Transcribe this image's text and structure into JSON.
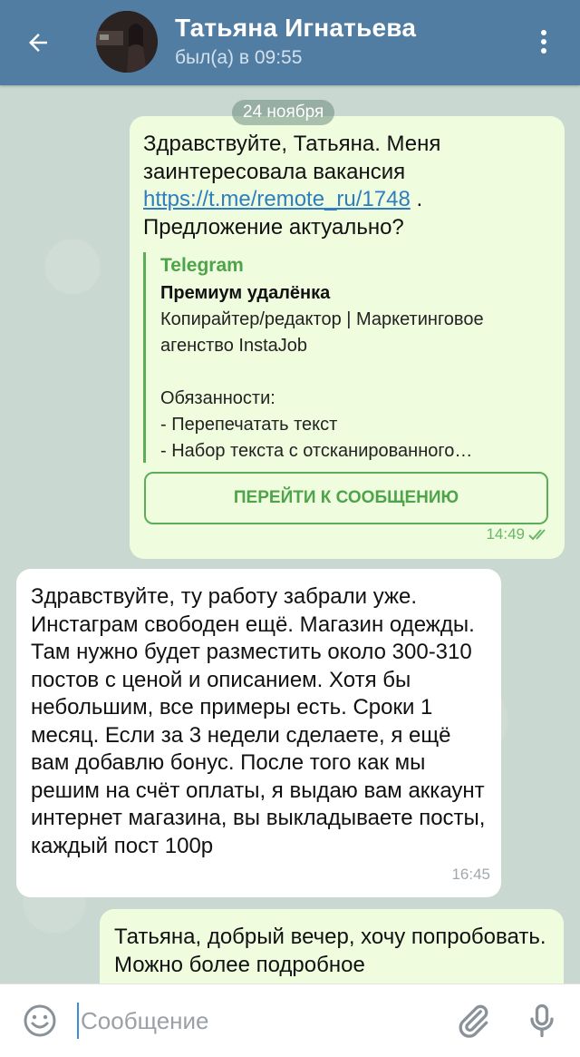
{
  "header": {
    "title": "Татьяна Игнатьева",
    "status": "был(а) в 09:55",
    "icons": {
      "back": "arrow-left-icon",
      "menu": "more-vertical-icon",
      "avatar": "contact-avatar"
    },
    "color": "#517da2"
  },
  "chat": {
    "date": "24 ноября",
    "messages": [
      {
        "direction": "outgoing",
        "text_before_link": "Здравствуйте, Татьяна. Меня заинтересовала вакансия ",
        "link": "https://t.me/remote_ru/1748",
        "text_after_link": " . Предложение актуально?",
        "preview": {
          "site": "Telegram",
          "title": "Премиум удалёнка",
          "description": "Копирайтер/редактор | Маркетинговое агенство InstaJob\n\n Обязанности:\n- Перепечатать текст\n- Набор текста с отсканированного…",
          "button": "ПЕРЕЙТИ К СООБЩЕНИЮ"
        },
        "time": "14:49",
        "status_icon": "double-check-icon"
      },
      {
        "direction": "incoming",
        "text": "Здравствуйте, ту работу забрали уже. Инстаграм свободен ещё.  Магазин одежды. Там нужно будет разместить около 300-310 постов с ценой и описанием. Хотя бы небольшим, все примеры есть. Сроки 1 месяц. Если за 3 недели сделаете, я ещё вам добавлю бонус. После того как мы решим на счёт оплаты, я выдаю вам аккаунт интернет магазина, вы выкладываете посты, каждый пост 100р",
        "time": "16:45"
      },
      {
        "direction": "outgoing",
        "text": "Татьяна, добрый вечер, хочу попробовать. Можно более подробное"
      }
    ]
  },
  "input": {
    "placeholder": "Сообщение",
    "value": "",
    "icons": {
      "emoji": "emoji-icon",
      "attach": "paperclip-icon",
      "mic": "microphone-icon"
    }
  },
  "colors": {
    "outgoing_bubble": "#effdde",
    "incoming_bubble": "#ffffff",
    "link": "#2e7dc1",
    "preview_accent": "#4ea34b"
  }
}
